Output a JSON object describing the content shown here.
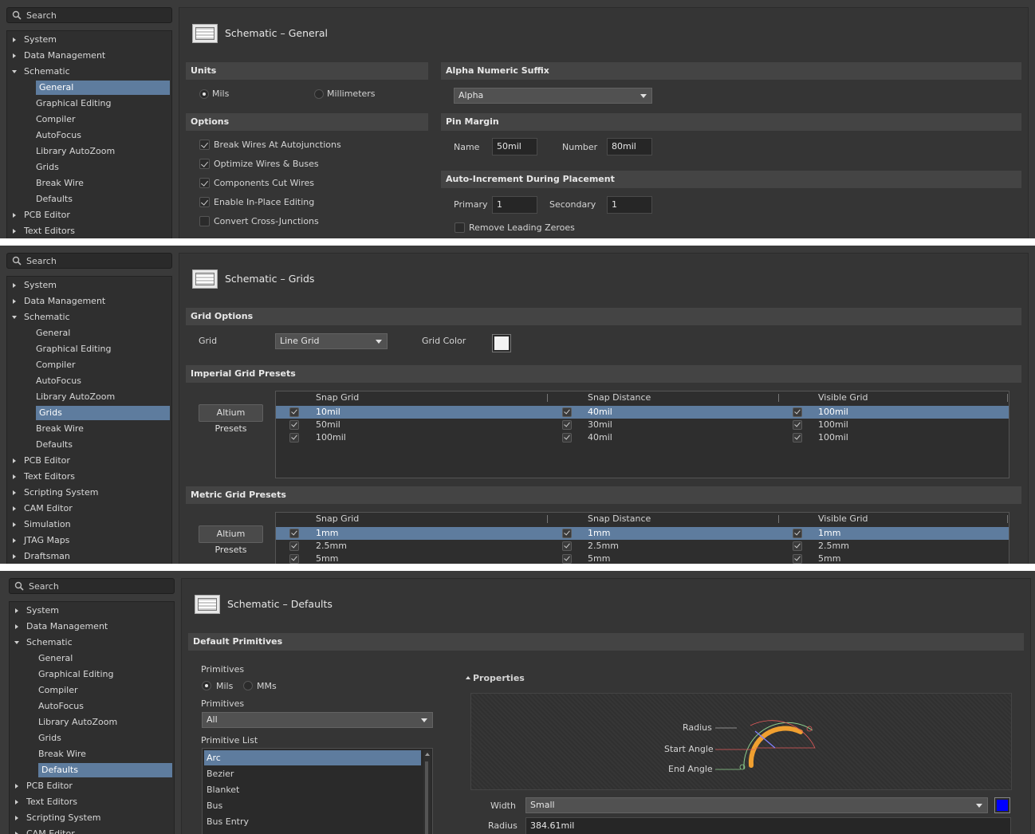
{
  "search_placeholder": "Search",
  "panel1": {
    "nav": [
      "System",
      "Data Management",
      "Schematic",
      "General",
      "Graphical Editing",
      "Compiler",
      "AutoFocus",
      "Library AutoZoom",
      "Grids",
      "Break Wire",
      "Defaults",
      "PCB Editor",
      "Text Editors"
    ],
    "title": "Schematic – General",
    "units": {
      "header": "Units",
      "mils": "Mils",
      "mm": "Millimeters"
    },
    "options": {
      "header": "Options",
      "items": [
        "Break Wires At Autojunctions",
        "Optimize Wires & Buses",
        "Components Cut Wires",
        "Enable In-Place Editing",
        "Convert Cross-Junctions"
      ]
    },
    "alpha": {
      "header": "Alpha Numeric Suffix",
      "value": "Alpha"
    },
    "pin_margin": {
      "header": "Pin Margin",
      "name_label": "Name",
      "name_value": "50mil",
      "number_label": "Number",
      "number_value": "80mil"
    },
    "auto_inc": {
      "header": "Auto-Increment During Placement",
      "primary_label": "Primary",
      "primary_value": "1",
      "secondary_label": "Secondary",
      "secondary_value": "1",
      "remove_zeroes": "Remove Leading Zeroes"
    }
  },
  "panel2": {
    "nav": [
      "System",
      "Data Management",
      "Schematic",
      "General",
      "Graphical Editing",
      "Compiler",
      "AutoFocus",
      "Library AutoZoom",
      "Grids",
      "Break Wire",
      "Defaults",
      "PCB Editor",
      "Text Editors",
      "Scripting System",
      "CAM Editor",
      "Simulation",
      "JTAG Maps",
      "Draftsman"
    ],
    "title": "Schematic – Grids",
    "grid_options": {
      "header": "Grid Options",
      "grid_label": "Grid",
      "grid_value": "Line Grid",
      "color_label": "Grid Color",
      "color": "#f2f2f2"
    },
    "imperial": {
      "header": "Imperial Grid Presets",
      "button": "Altium Presets",
      "cols": [
        "Snap Grid",
        "Snap Distance",
        "Visible Grid"
      ],
      "rows": [
        [
          "10mil",
          "40mil",
          "100mil"
        ],
        [
          "50mil",
          "30mil",
          "100mil"
        ],
        [
          "100mil",
          "40mil",
          "100mil"
        ]
      ]
    },
    "metric": {
      "header": "Metric Grid Presets",
      "button": "Altium Presets",
      "cols": [
        "Snap Grid",
        "Snap Distance",
        "Visible Grid"
      ],
      "rows": [
        [
          "1mm",
          "1mm",
          "1mm"
        ],
        [
          "2.5mm",
          "2.5mm",
          "2.5mm"
        ],
        [
          "5mm",
          "5mm",
          "5mm"
        ]
      ]
    }
  },
  "panel3": {
    "nav": [
      "System",
      "Data Management",
      "Schematic",
      "General",
      "Graphical Editing",
      "Compiler",
      "AutoFocus",
      "Library AutoZoom",
      "Grids",
      "Break Wire",
      "Defaults",
      "PCB Editor",
      "Text Editors",
      "Scripting System",
      "CAM Editor"
    ],
    "title": "Schematic – Defaults",
    "section": "Default Primitives",
    "primitives_label": "Primitives",
    "mils": "Mils",
    "mms": "MMs",
    "primitives_label2": "Primitives",
    "primitives_value": "All",
    "list_label": "Primitive List",
    "list": [
      "Arc",
      "Bezier",
      "Blanket",
      "Bus",
      "Bus Entry"
    ],
    "properties": "Properties",
    "radius_lbl": "Radius",
    "start_angle_lbl": "Start Angle",
    "end_angle_lbl": "End Angle",
    "width_label": "Width",
    "width_value": "Small",
    "width_color": "#0000ff",
    "radius_label": "Radius",
    "radius_value": "384.61mil"
  }
}
